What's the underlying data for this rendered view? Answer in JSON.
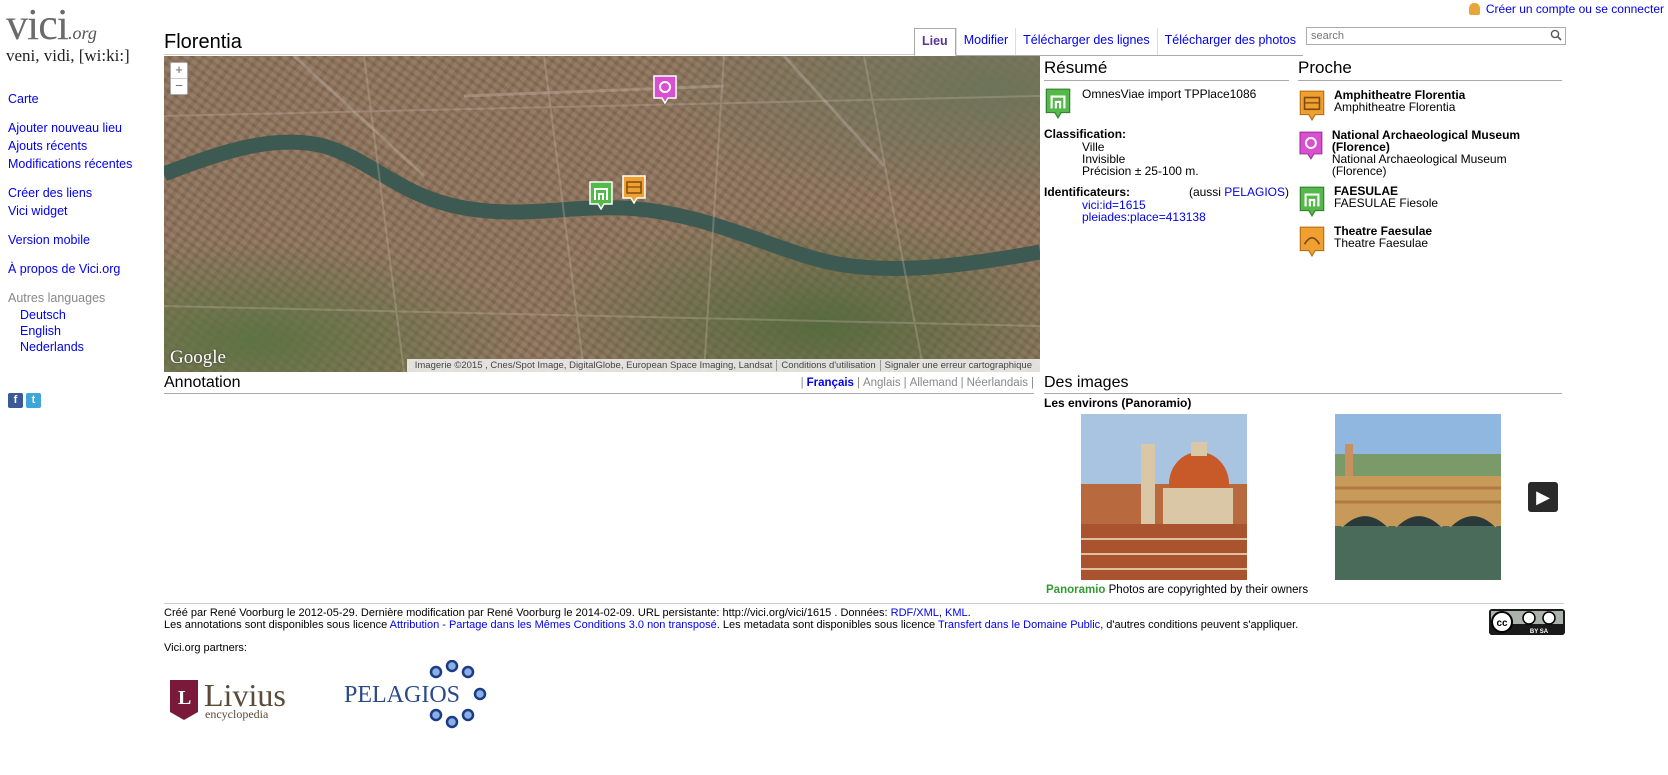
{
  "logo": {
    "main": "vici",
    "suffix": ".org",
    "tagline": "veni, vidi, [wi:ki:]"
  },
  "account": {
    "link": "Créer un compte ou se connecter"
  },
  "nav": {
    "map": "Carte",
    "add_place": "Ajouter nouveau lieu",
    "recent_additions": "Ajouts récents",
    "recent_changes": "Modifications récentes",
    "create_links": "Créer des liens",
    "widget": "Vici widget",
    "mobile": "Version mobile",
    "about": "À propos de Vici.org",
    "other_languages": "Autres languages",
    "languages": [
      "Deutsch",
      "English",
      "Nederlands"
    ]
  },
  "social": {
    "facebook": "f",
    "twitter": "t"
  },
  "page": {
    "title": "Florentia"
  },
  "tabs": [
    "Lieu",
    "Modifier",
    "Télécharger des lignes",
    "Télécharger des photos"
  ],
  "search": {
    "placeholder": "search"
  },
  "map": {
    "zoom_in": "+",
    "zoom_out": "−",
    "provider": "Google",
    "credits": [
      "Imagerie ©2015 , Cnes/Spot Image, DigitalGlobe, European Space Imaging, Landsat",
      "Conditions d'utilisation",
      "Signaler une erreur cartographique"
    ]
  },
  "resume": {
    "heading": "Résumé",
    "description": "OmnesViae import TPPlace1086",
    "classification_label": "Classification:",
    "classification": [
      "Ville",
      "Invisible",
      "Précision ± 25-100 m."
    ],
    "identifiers_label": "Identificateurs:",
    "also_prefix": "(aussi ",
    "also_link": "PELAGIOS",
    "also_suffix": ")",
    "identifiers": [
      "vici:id=1615",
      "pleiades:place=413138"
    ]
  },
  "proche": {
    "heading": "Proche",
    "items": [
      {
        "name": "Amphitheatre Florentia",
        "sub": "Amphitheatre Florentia",
        "icon": "amphitheatre-icon"
      },
      {
        "name": "National Archaeological Museum (Florence)",
        "sub": "National Archaeological Museum (Florence)",
        "icon": "museum-icon"
      },
      {
        "name": "FAESULAE",
        "sub": "FAESULAE Fiesole",
        "icon": "city-icon"
      },
      {
        "name": "Theatre Faesulae",
        "sub": "Theatre Faesulae",
        "icon": "theatre-icon"
      }
    ]
  },
  "annotation": {
    "heading": "Annotation",
    "languages": [
      "Français",
      "Anglais",
      "Allemand",
      "Néerlandais"
    ]
  },
  "images": {
    "heading": "Des images",
    "subheading": "Les environs (Panoramio)",
    "panoramio_brand": "Panoramio",
    "panoramio_note": "Photos are copyrighted by their owners"
  },
  "footer": {
    "line1_text": "Créé par René Voorburg le 2012-05-29. Dernière modification par René Voorburg le 2014-02-09. URL persistante: http://vici.org/vici/1615 . Données: ",
    "line1_link1": "RDF/XML",
    "line1_sep": ", ",
    "line1_link2": "KML",
    "line1_end": ".",
    "line2_text1": "Les annotations sont disponibles sous licence ",
    "line2_link1": "Attribution - Partage dans les Mêmes Conditions 3.0 non transposé",
    "line2_text2": ". Les metadata sont disponibles sous licence ",
    "line2_link2": "Transfert dans le Domaine Public",
    "line2_text3": ", d'autres conditions peuvent s'appliquer.",
    "partners_label": "Vici.org partners:",
    "cc_label": "BY SA"
  },
  "partners": {
    "livius_letter": "L",
    "livius_name": "Livius",
    "livius_sub": "encyclopedia",
    "pelagios": "PELAGIOS"
  },
  "colors": {
    "link": "#0000ee",
    "city_marker": "#55b84a",
    "museum_marker": "#d84fd0",
    "amphi_marker": "#f0a030"
  }
}
